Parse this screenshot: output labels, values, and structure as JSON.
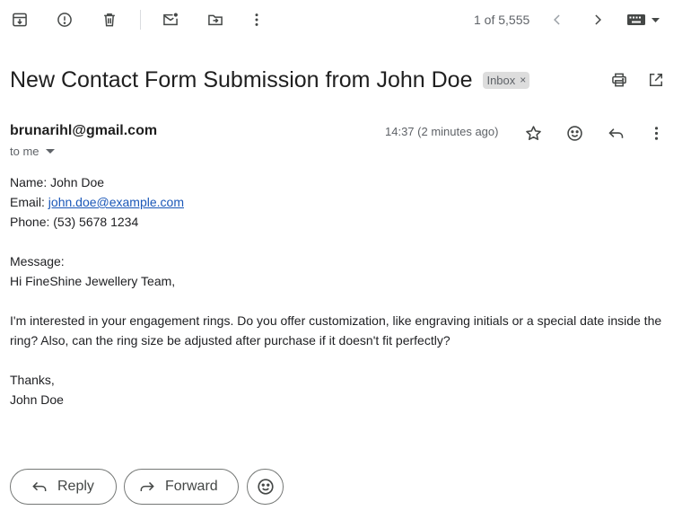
{
  "toolbar": {
    "icons": [
      "archive-icon",
      "report-spam-icon",
      "delete-icon",
      "mark-unread-icon",
      "move-to-icon",
      "more-vert-icon"
    ],
    "counter": "1 of 5,555"
  },
  "email": {
    "subject": "New Contact Form Submission from John Doe",
    "label": "Inbox",
    "label_close": "×",
    "sender": "brunarihl@gmail.com",
    "to": "to me",
    "time": "14:37 (2 minutes ago)",
    "body": {
      "name_line": "Name: John Doe",
      "email_prefix": "Email: ",
      "email_link": "john.doe@example.com",
      "phone_line": "Phone: (53) 5678 1234",
      "message_label": "Message:",
      "greeting": "Hi FineShine Jewellery Team,",
      "paragraph": "I'm interested in your engagement rings. Do you offer customization, like engraving initials or a special date inside the ring? Also, can the ring size be adjusted after purchase if it doesn't fit perfectly?",
      "thanks": "Thanks,",
      "signature": "John Doe"
    }
  },
  "actions": {
    "reply": "Reply",
    "forward": "Forward"
  },
  "colors": {
    "text": "#202124",
    "muted": "#5f6368",
    "link": "#1a57b8",
    "badge_bg": "#dddddd"
  }
}
